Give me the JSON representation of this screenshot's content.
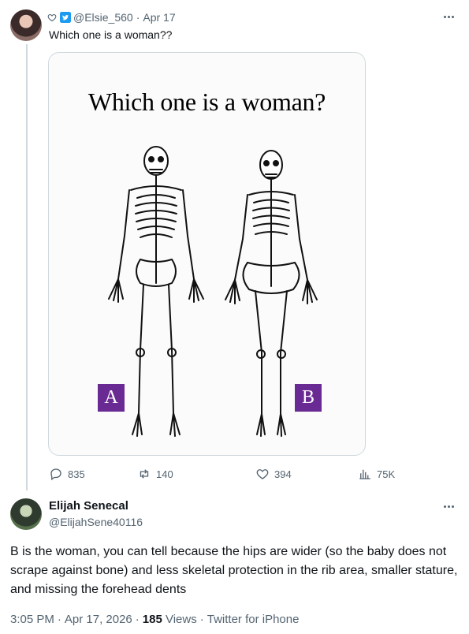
{
  "original_tweet": {
    "handle": "@Elsie_560",
    "date": "Apr 17",
    "separator": "·",
    "text": "Which one is a woman??",
    "media": {
      "title": "Which one is a woman?",
      "label_a": "A",
      "label_b": "B"
    },
    "actions": {
      "replies": "835",
      "retweets": "140",
      "likes": "394",
      "views": "75K"
    }
  },
  "reply": {
    "name": "Elijah Senecal",
    "handle": "@ElijahSene40116",
    "text": "B is the woman, you can tell because the hips are wider (so the baby does not scrape against bone) and less skeletal protection in the rib area, smaller stature, and missing the forehead dents",
    "time": "3:05 PM",
    "date": "Apr 17, 2026",
    "views_count": "185",
    "views_label": "Views",
    "source": "Twitter for iPhone",
    "dot": "·"
  },
  "icons": [
    "heart-outline-icon",
    "twitter-bird-icon",
    "more-icon",
    "reply-icon",
    "retweet-icon",
    "like-icon",
    "views-icon"
  ],
  "colors": {
    "secondary_text": "#536471",
    "primary_text": "#0f1419",
    "label_purple": "#6a2a93",
    "border": "#cfd9de"
  }
}
